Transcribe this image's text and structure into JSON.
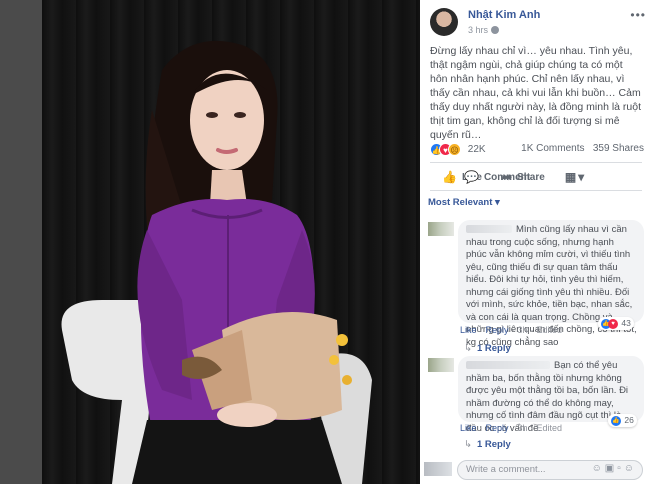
{
  "post": {
    "author": "Nhật Kim Anh",
    "time": "3 hrs",
    "more_label": "•••",
    "text": "Đừng lấy nhau chỉ vì… yêu nhau. Tình yêu, thật ngậm ngùi, chả giúp chúng ta có một hôn nhân hạnh phúc. Chỉ nên lấy nhau, vì thấy cần nhau, cả khi vui lẫn khi buồn… Cảm thấy duy nhất người này, là đồng minh là ruột thịt tim gan, không chỉ là đối tượng si mê quyến rũ…",
    "reaction_count": "22K",
    "comments_count": "1K Comments",
    "shares_count": "359 Shares",
    "reaction_icons": [
      "like-icon",
      "love-icon",
      "sad-icon"
    ]
  },
  "actions": {
    "like_label": "Like",
    "comment_label": "Comment",
    "share_label": "Share"
  },
  "sort_label": "Most Relevant",
  "comments": [
    {
      "text": "Mình cũng lấy nhau vì cần nhau trong cuộc sống, nhưng hạnh phúc vẫn không mỉm cười, vì thiếu tình yêu, cũng thiếu đi sự quan tâm thấu hiểu. Đôi khi tự hỏi, tình yêu thì hiếm, nhưng cái giống tình yêu thì nhiều. Đối với mình, sức khỏe, tiền bạc, nhan sắc, và con cái là quan trọng. Chồng và những gì liên quan đến chồng, có thì tốt, kg có cũng chẳng sao",
      "like_label": "Like",
      "reply_label": "Reply",
      "time": "3h",
      "edited_label": "Edited",
      "reaction_count": "43",
      "replies_label": "1 Reply"
    },
    {
      "text": "Bạn có thể yêu nhầm ba, bốn thằng tồi nhưng không được yêu một thằng tồi ba, bốn lần. Đi nhầm đường có thể do không may, nhưng cố tình đâm đầu ngõ cụt thì là đầu óc có vấn đề.",
      "like_label": "Like",
      "reply_label": "Reply",
      "time": "3h",
      "edited_label": "Edited",
      "reaction_count": "26",
      "replies_label": "1 Reply"
    }
  ],
  "write_comment": {
    "placeholder": "Write a comment..."
  },
  "colors": {
    "link_blue": "#385898",
    "like_blue": "#2078f4",
    "love_red": "#f0284a",
    "purple_dress": "#7a2c9a"
  }
}
